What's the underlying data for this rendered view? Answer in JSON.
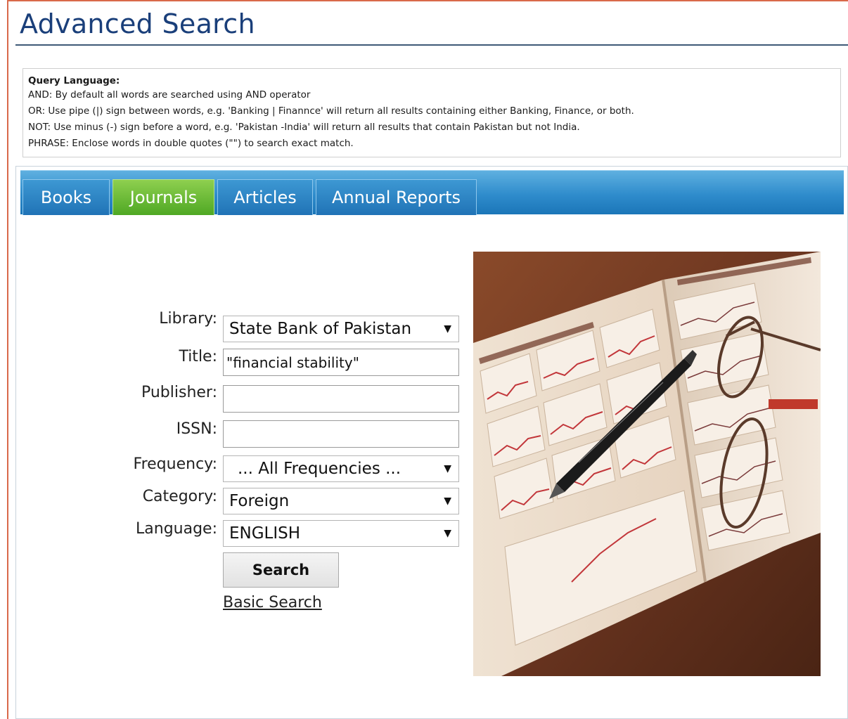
{
  "page": {
    "title": "Advanced Search"
  },
  "query_help": {
    "heading": "Query Language:",
    "lines": [
      "AND: By default all words are searched using AND operator",
      "OR: Use pipe (|) sign between words, e.g. 'Banking | Finannce' will return all results containing either Banking, Finance, or both.",
      "NOT: Use minus (-) sign before a word, e.g. 'Pakistan -India' will return all results that contain Pakistan but not India.",
      "PHRASE: Enclose words in double quotes (\"\") to search exact match."
    ]
  },
  "tabs": [
    {
      "label": "Books",
      "active": false
    },
    {
      "label": "Journals",
      "active": true
    },
    {
      "label": "Articles",
      "active": false
    },
    {
      "label": "Annual Reports",
      "active": false
    }
  ],
  "form": {
    "library": {
      "label": "Library:",
      "value": "State Bank of Pakistan"
    },
    "title": {
      "label": "Title:",
      "value": "\"financial stability\""
    },
    "publisher": {
      "label": "Publisher:",
      "value": ""
    },
    "issn": {
      "label": "ISSN:",
      "value": ""
    },
    "frequency": {
      "label": "Frequency:",
      "value": "... All Frequencies ..."
    },
    "category": {
      "label": "Category:",
      "value": "Foreign"
    },
    "language": {
      "label": "Language:",
      "value": "ENGLISH"
    },
    "search_label": "Search",
    "basic_search_label": "Basic Search"
  },
  "colors": {
    "title": "#1a3f7a",
    "tab_bar": "#2f8ccc",
    "tab_active": "#4fa824",
    "frame_border": "#d9694a"
  },
  "image": {
    "icon": "financial-newspaper-photo"
  }
}
